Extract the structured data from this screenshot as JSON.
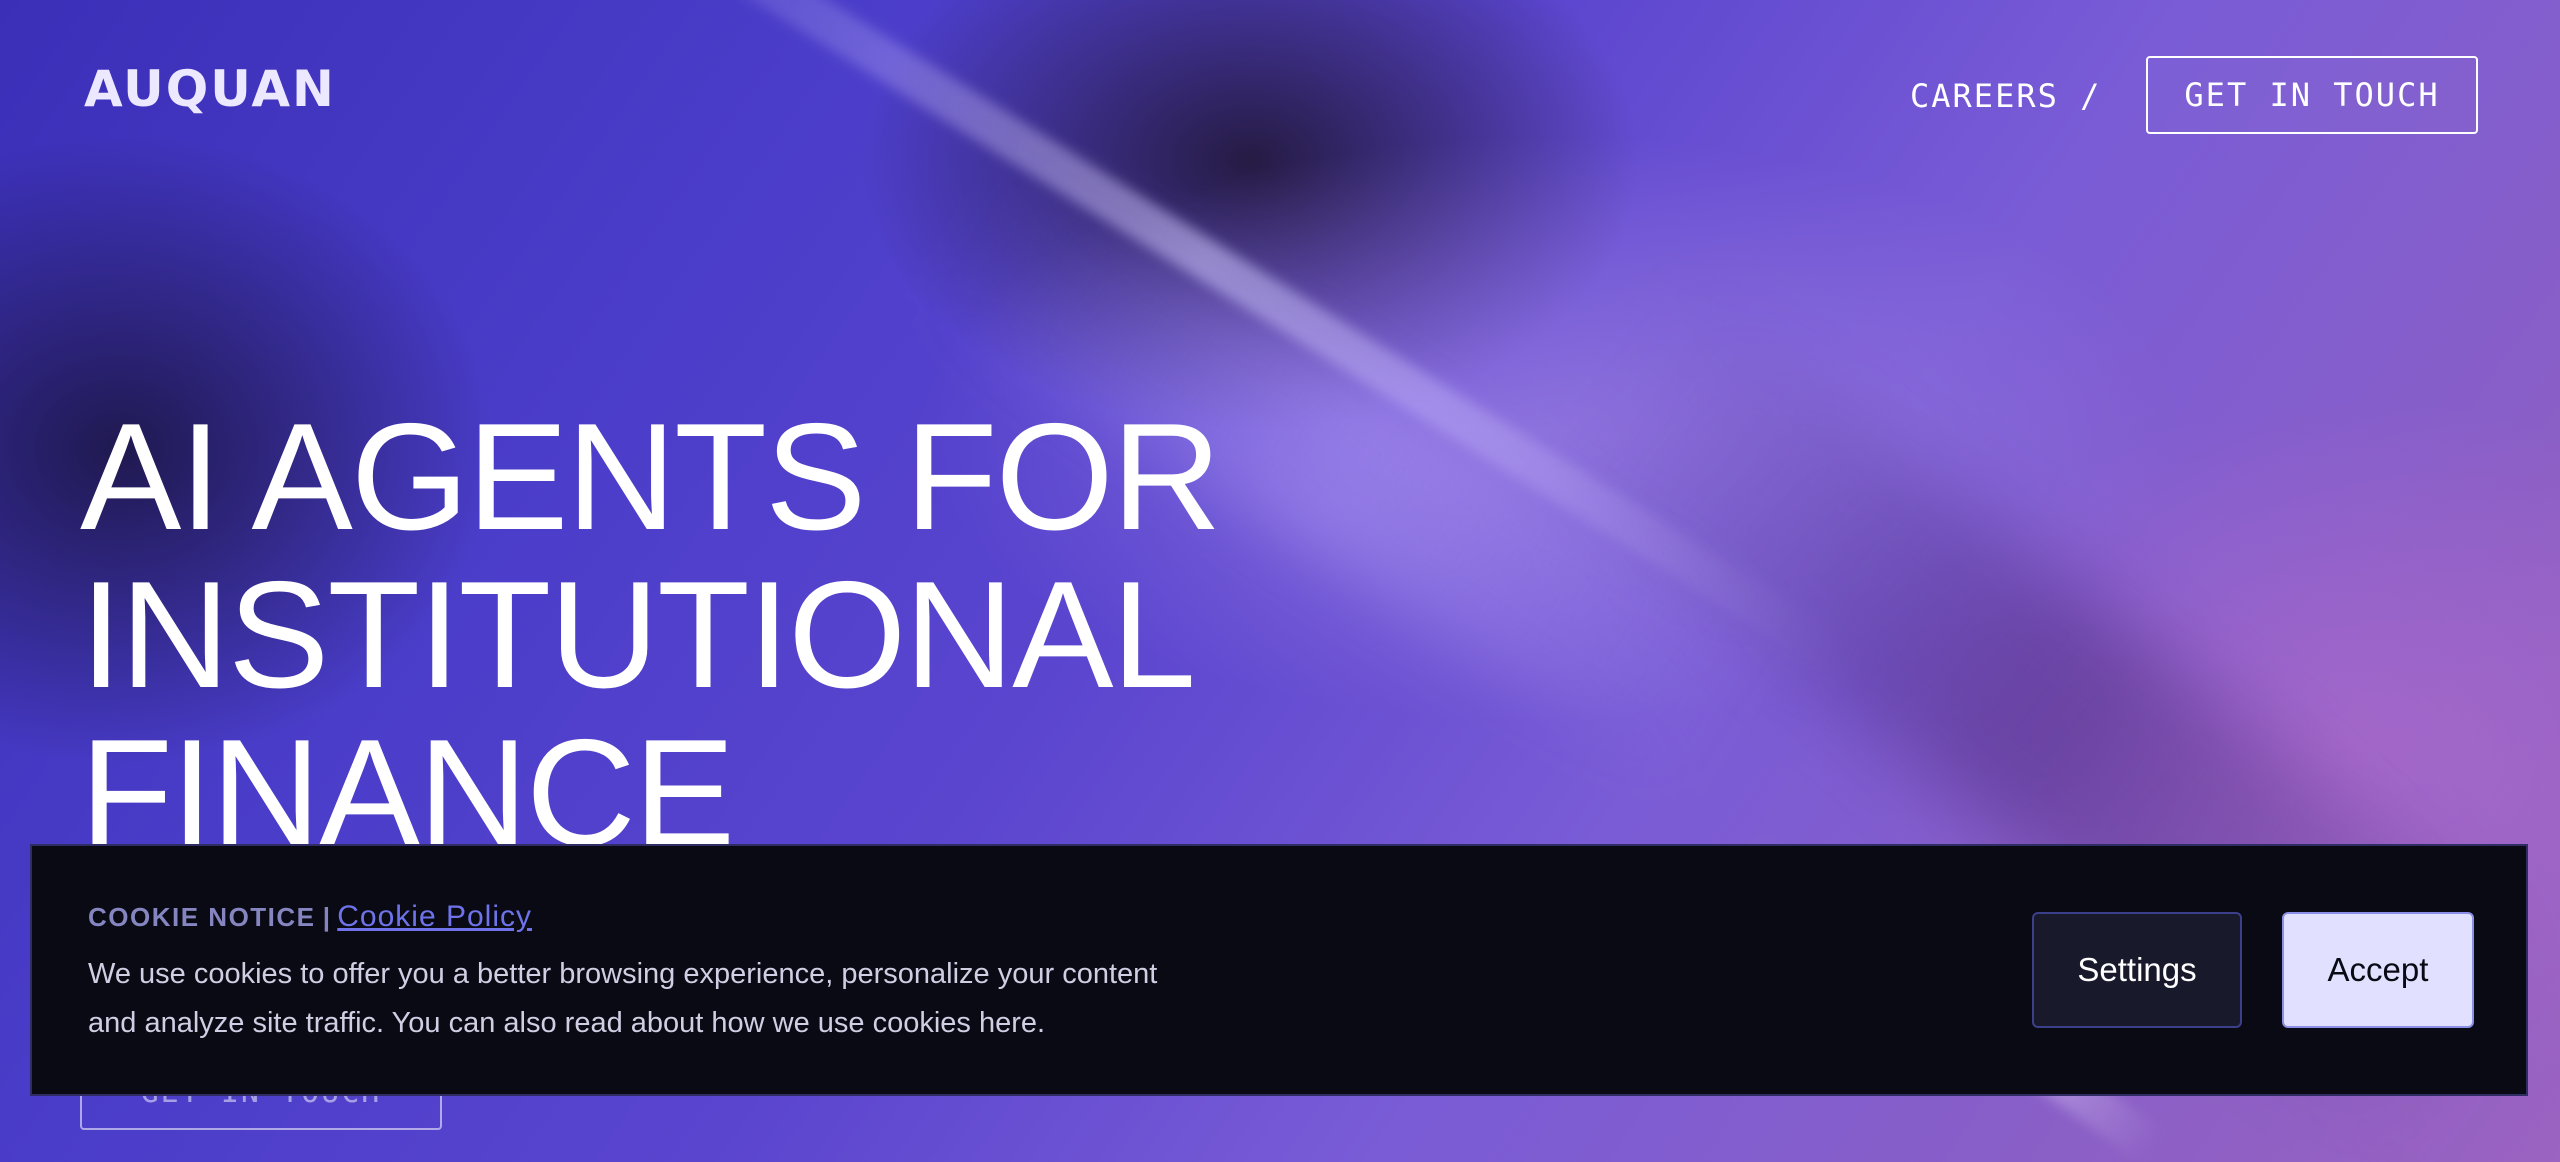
{
  "header": {
    "logo_text": "AUQUAN",
    "careers_label": "CAREERS /",
    "cta_label": "GET IN TOUCH"
  },
  "hero": {
    "headline_lines": [
      "AI AGENTS FOR",
      "INSTITUTIONAL",
      "FINANCE"
    ],
    "cta_label": "GET IN TOUCH"
  },
  "cookie_banner": {
    "title": "COOKIE NOTICE",
    "separator": "|",
    "policy_link": "Cookie Policy",
    "body": "We use cookies to offer you a better browsing experience, personalize your content and analyze site traffic. You can also read about how we use cookies here.",
    "settings_label": "Settings",
    "accept_label": "Accept"
  },
  "colors": {
    "banner_bg": "#0a0a15",
    "link": "#6f73ea",
    "accept_bg": "#e1e1ff",
    "hero_purple": "#5a45cf"
  }
}
